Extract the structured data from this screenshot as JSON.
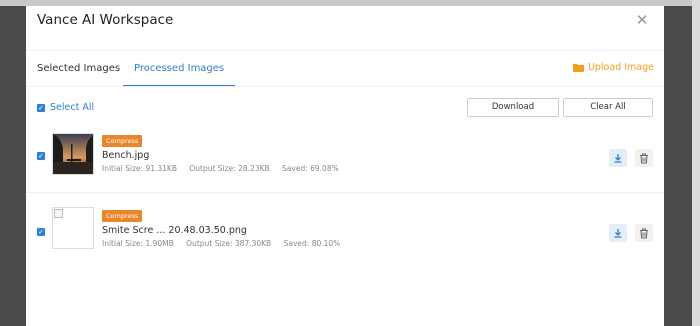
{
  "modal": {
    "title": "Vance AI Workspace"
  },
  "tabs": [
    {
      "label": "Selected Images",
      "active": false
    },
    {
      "label": "Processed Images",
      "active": true
    }
  ],
  "upload_label": "Upload Image",
  "select_all_label": "Select All",
  "buttons": {
    "download": "Download",
    "clear_all": "Clear All"
  },
  "items": [
    {
      "badge": "Compress",
      "filename": "Bench.jpg",
      "initial_size": "Initial Size: 91.31KB",
      "output_size": "Output Size: 28.23KB",
      "saved": "Saved: 69.08%",
      "checked": true,
      "thumbnail": "sunset-bench-photo"
    },
    {
      "badge": "Compress",
      "filename": "Smite Scre ... 20.48.03.50.png",
      "initial_size": "Initial Size: 1.90MB",
      "output_size": "Output Size: 387.30KB",
      "saved": "Saved: 80.10%",
      "checked": true,
      "thumbnail": "broken-image"
    }
  ],
  "colors": {
    "accent": "#2f80d1",
    "upload": "#f0a020",
    "badge": "#e9862a"
  }
}
